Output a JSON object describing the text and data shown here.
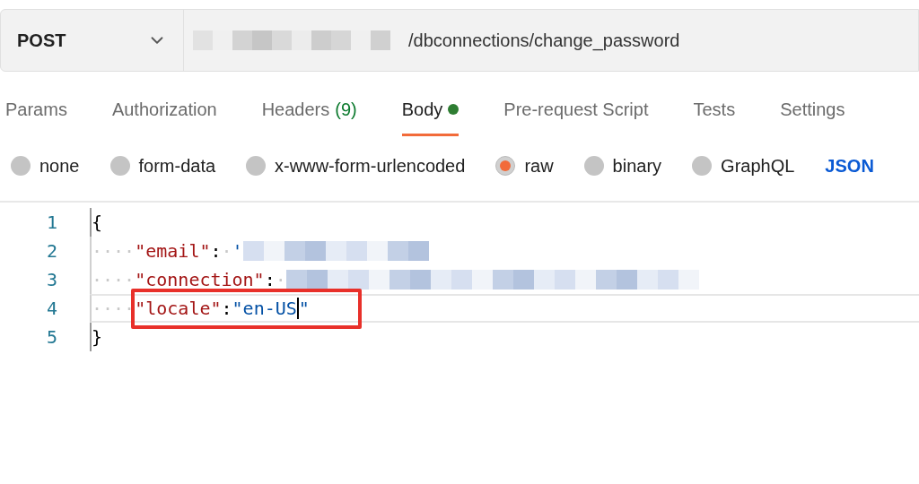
{
  "request": {
    "method": "POST",
    "url_path": "/dbconnections/change_password"
  },
  "tabs": [
    {
      "label": "Params",
      "selected": false
    },
    {
      "label": "Authorization",
      "selected": false
    },
    {
      "label": "Headers",
      "count": "(9)",
      "selected": false
    },
    {
      "label": "Body",
      "dot": true,
      "selected": true
    },
    {
      "label": "Pre-request Script",
      "selected": false
    },
    {
      "label": "Tests",
      "selected": false
    },
    {
      "label": "Settings",
      "selected": false
    }
  ],
  "body_types": [
    {
      "label": "none",
      "selected": false
    },
    {
      "label": "form-data",
      "selected": false
    },
    {
      "label": "x-www-form-urlencoded",
      "selected": false
    },
    {
      "label": "raw",
      "selected": true
    },
    {
      "label": "binary",
      "selected": false
    },
    {
      "label": "GraphQL",
      "selected": false
    }
  ],
  "format": "JSON",
  "editor": {
    "lines": [
      {
        "number": "1",
        "current": false,
        "highlighted": false,
        "tokens": [
          {
            "kind": "punct",
            "text": "{"
          }
        ]
      },
      {
        "number": "2",
        "current": false,
        "highlighted": false,
        "tokens": [
          {
            "kind": "indent",
            "text": "····"
          },
          {
            "kind": "key",
            "text": "\"email\""
          },
          {
            "kind": "punct",
            "text": ":"
          },
          {
            "kind": "indent",
            "text": "·"
          },
          {
            "kind": "string",
            "text": "'"
          },
          {
            "kind": "redacted"
          }
        ]
      },
      {
        "number": "3",
        "current": false,
        "highlighted": false,
        "tokens": [
          {
            "kind": "indent",
            "text": "····"
          },
          {
            "kind": "key",
            "text": "\"connection\""
          },
          {
            "kind": "punct",
            "text": ":"
          },
          {
            "kind": "indent",
            "text": "·"
          },
          {
            "kind": "redacted"
          }
        ]
      },
      {
        "number": "4",
        "current": true,
        "highlighted": true,
        "tokens": [
          {
            "kind": "indent",
            "text": "····"
          },
          {
            "kind": "key",
            "text": "\"locale\""
          },
          {
            "kind": "punct",
            "text": ":"
          },
          {
            "kind": "string",
            "text": "\"en-US"
          },
          {
            "kind": "cursor"
          },
          {
            "kind": "string",
            "text": "\""
          }
        ]
      },
      {
        "number": "5",
        "current": false,
        "highlighted": false,
        "tokens": [
          {
            "kind": "punct",
            "text": "}"
          }
        ]
      }
    ]
  }
}
